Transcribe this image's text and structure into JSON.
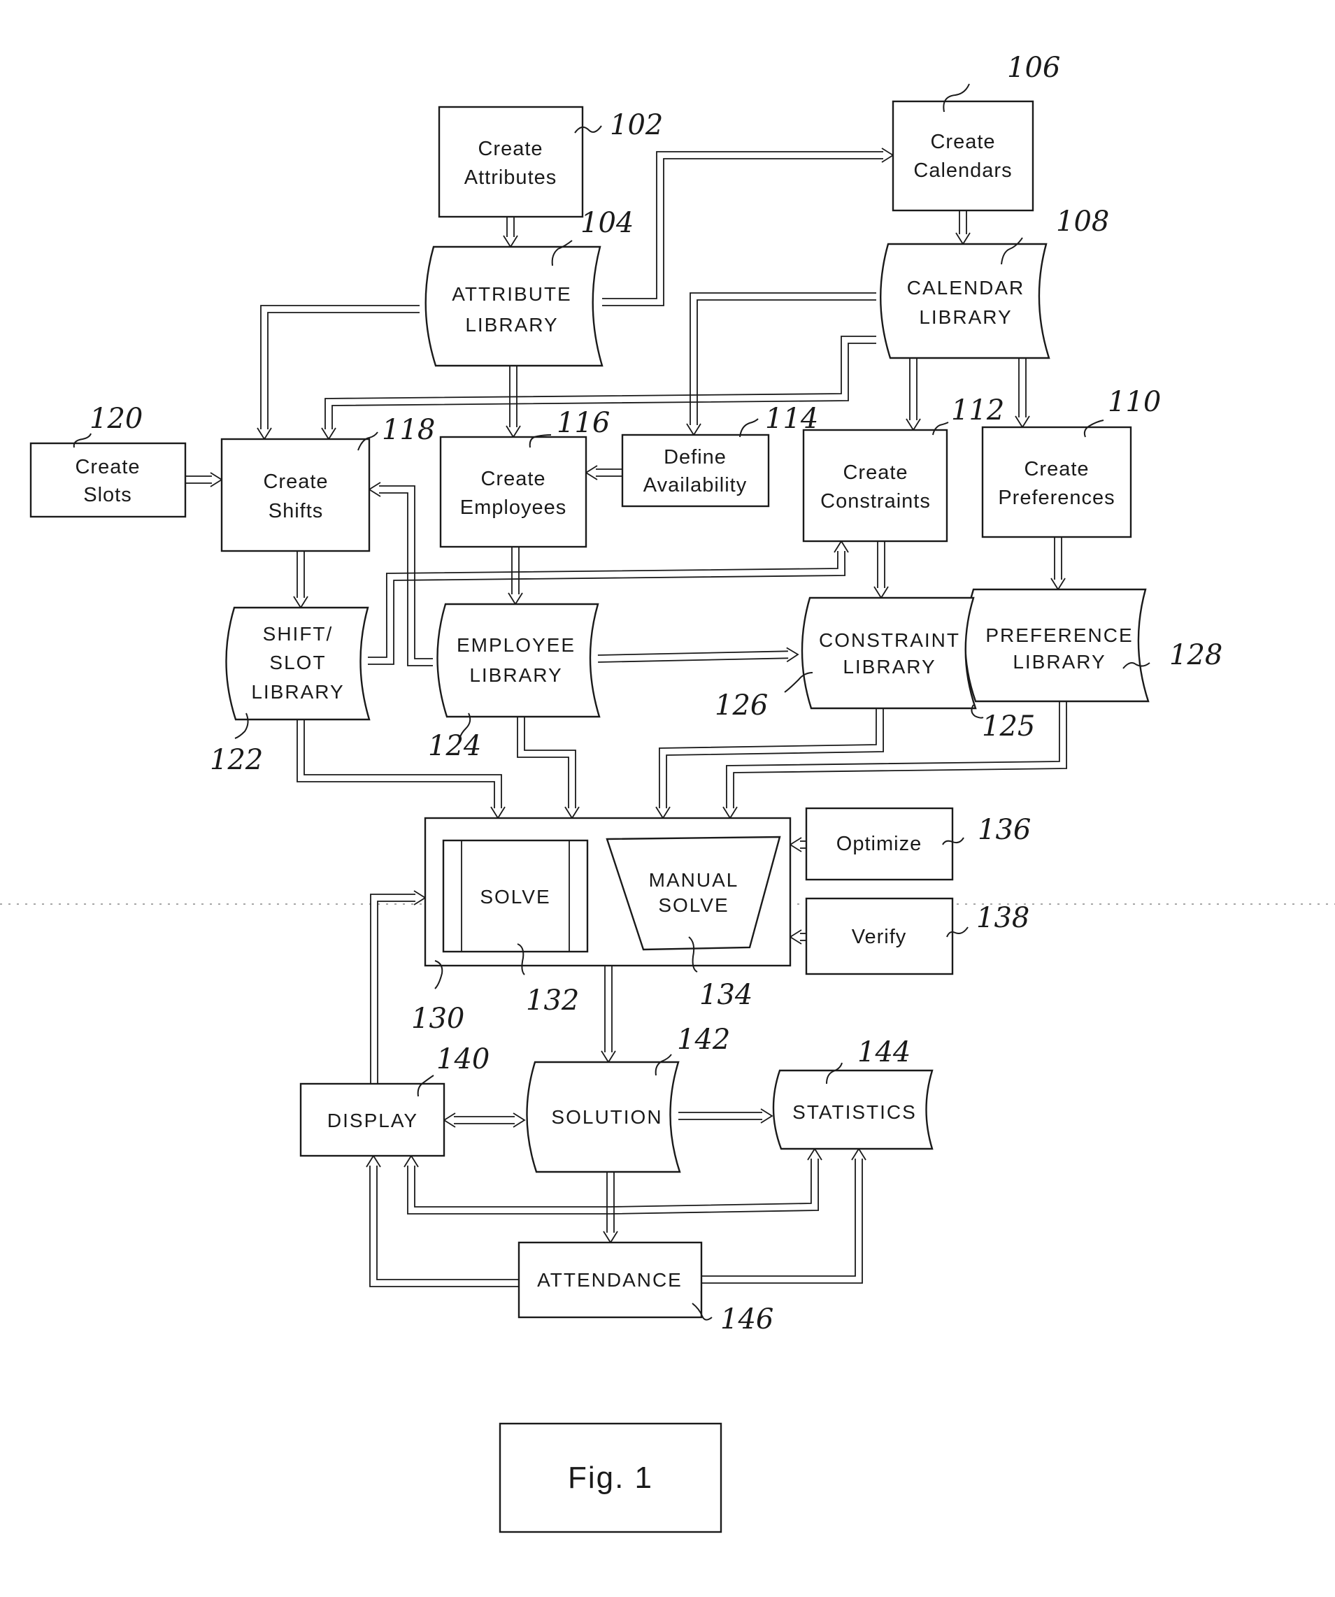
{
  "figure": {
    "caption": "Fig. 1"
  },
  "nodes": {
    "create_attributes": {
      "lines": [
        "Create",
        "Attributes"
      ],
      "ref": "102",
      "shape": "process"
    },
    "create_calendars": {
      "lines": [
        "Create",
        "Calendars"
      ],
      "ref": "106",
      "shape": "process"
    },
    "attribute_library": {
      "lines": [
        "ATTRIBUTE",
        "LIBRARY"
      ],
      "ref": "104",
      "shape": "stored-data"
    },
    "calendar_library": {
      "lines": [
        "CALENDAR",
        "LIBRARY"
      ],
      "ref": "108",
      "shape": "stored-data"
    },
    "create_slots": {
      "lines": [
        "Create",
        "Slots"
      ],
      "ref": "120",
      "shape": "process"
    },
    "create_shifts": {
      "lines": [
        "Create",
        "Shifts"
      ],
      "ref": "118",
      "shape": "process"
    },
    "create_employees": {
      "lines": [
        "Create",
        "Employees"
      ],
      "ref": "116",
      "shape": "process"
    },
    "define_availability": {
      "lines": [
        "Define",
        "Availability"
      ],
      "ref": "114",
      "shape": "process"
    },
    "create_constraints": {
      "lines": [
        "Create",
        "Constraints"
      ],
      "ref": "112",
      "shape": "process"
    },
    "create_preferences": {
      "lines": [
        "Create",
        "Preferences"
      ],
      "ref": "110",
      "shape": "process"
    },
    "shift_slot_library": {
      "lines": [
        "SHIFT/",
        "SLOT",
        "LIBRARY"
      ],
      "ref": "122",
      "shape": "stored-data"
    },
    "employee_library": {
      "lines": [
        "EMPLOYEE",
        "LIBRARY"
      ],
      "ref": "124",
      "shape": "stored-data"
    },
    "constraint_library": {
      "lines": [
        "CONSTRAINT",
        "LIBRARY"
      ],
      "ref": "126",
      "shape": "stored-data"
    },
    "preference_library": {
      "lines": [
        "PREFERENCE",
        "LIBRARY"
      ],
      "ref": "128",
      "shape": "stored-data"
    },
    "combined_library_ref": {
      "ref": "125"
    },
    "solver": {
      "ref": "130",
      "shape": "container"
    },
    "solve": {
      "lines": [
        "SOLVE"
      ],
      "ref": "132",
      "shape": "predefined-process"
    },
    "manual_solve": {
      "lines": [
        "MANUAL",
        "SOLVE"
      ],
      "ref": "134",
      "shape": "manual-operation"
    },
    "optimize": {
      "lines": [
        "Optimize"
      ],
      "ref": "136",
      "shape": "process"
    },
    "verify": {
      "lines": [
        "Verify"
      ],
      "ref": "138",
      "shape": "process"
    },
    "display": {
      "lines": [
        "DISPLAY"
      ],
      "ref": "140",
      "shape": "process"
    },
    "solution": {
      "lines": [
        "SOLUTION"
      ],
      "ref": "142",
      "shape": "stored-data"
    },
    "statistics": {
      "lines": [
        "STATISTICS"
      ],
      "ref": "144",
      "shape": "stored-data"
    },
    "attendance": {
      "lines": [
        "ATTENDANCE"
      ],
      "ref": "146",
      "shape": "process"
    }
  },
  "edges": [
    {
      "from": "create_attributes",
      "to": "attribute_library"
    },
    {
      "from": "attribute_library",
      "to": "create_calendars"
    },
    {
      "from": "create_calendars",
      "to": "calendar_library"
    },
    {
      "from": "attribute_library",
      "to": "create_shifts"
    },
    {
      "from": "attribute_library",
      "to": "create_employees"
    },
    {
      "from": "calendar_library",
      "to": "define_availability"
    },
    {
      "from": "calendar_library",
      "to": "create_shifts"
    },
    {
      "from": "calendar_library",
      "to": "create_constraints"
    },
    {
      "from": "calendar_library",
      "to": "create_preferences"
    },
    {
      "from": "create_slots",
      "to": "create_shifts"
    },
    {
      "from": "define_availability",
      "to": "create_employees"
    },
    {
      "from": "create_shifts",
      "to": "shift_slot_library"
    },
    {
      "from": "create_employees",
      "to": "employee_library"
    },
    {
      "from": "employee_library",
      "to": "create_shifts"
    },
    {
      "from": "shift_slot_library",
      "to": "create_constraints"
    },
    {
      "from": "employee_library",
      "to": "constraint_library"
    },
    {
      "from": "create_constraints",
      "to": "constraint_library"
    },
    {
      "from": "create_preferences",
      "to": "preference_library"
    },
    {
      "from": "shift_slot_library",
      "to": "solver"
    },
    {
      "from": "employee_library",
      "to": "solver"
    },
    {
      "from": "constraint_library",
      "to": "solver"
    },
    {
      "from": "preference_library",
      "to": "solver"
    },
    {
      "from": "optimize",
      "to": "solver"
    },
    {
      "from": "verify",
      "to": "solver"
    },
    {
      "from": "solve",
      "to": "manual_solve",
      "bidirectional": true
    },
    {
      "from": "display",
      "to": "solver"
    },
    {
      "from": "solver",
      "to": "solution"
    },
    {
      "from": "display",
      "to": "solution",
      "bidirectional": true
    },
    {
      "from": "solution",
      "to": "statistics"
    },
    {
      "from": "solution",
      "to": "attendance"
    },
    {
      "from": "attendance",
      "to": "display"
    },
    {
      "from": "attendance",
      "to": "statistics"
    },
    {
      "from": "solution",
      "to": "display"
    },
    {
      "from": "solution",
      "to": "statistics"
    }
  ]
}
